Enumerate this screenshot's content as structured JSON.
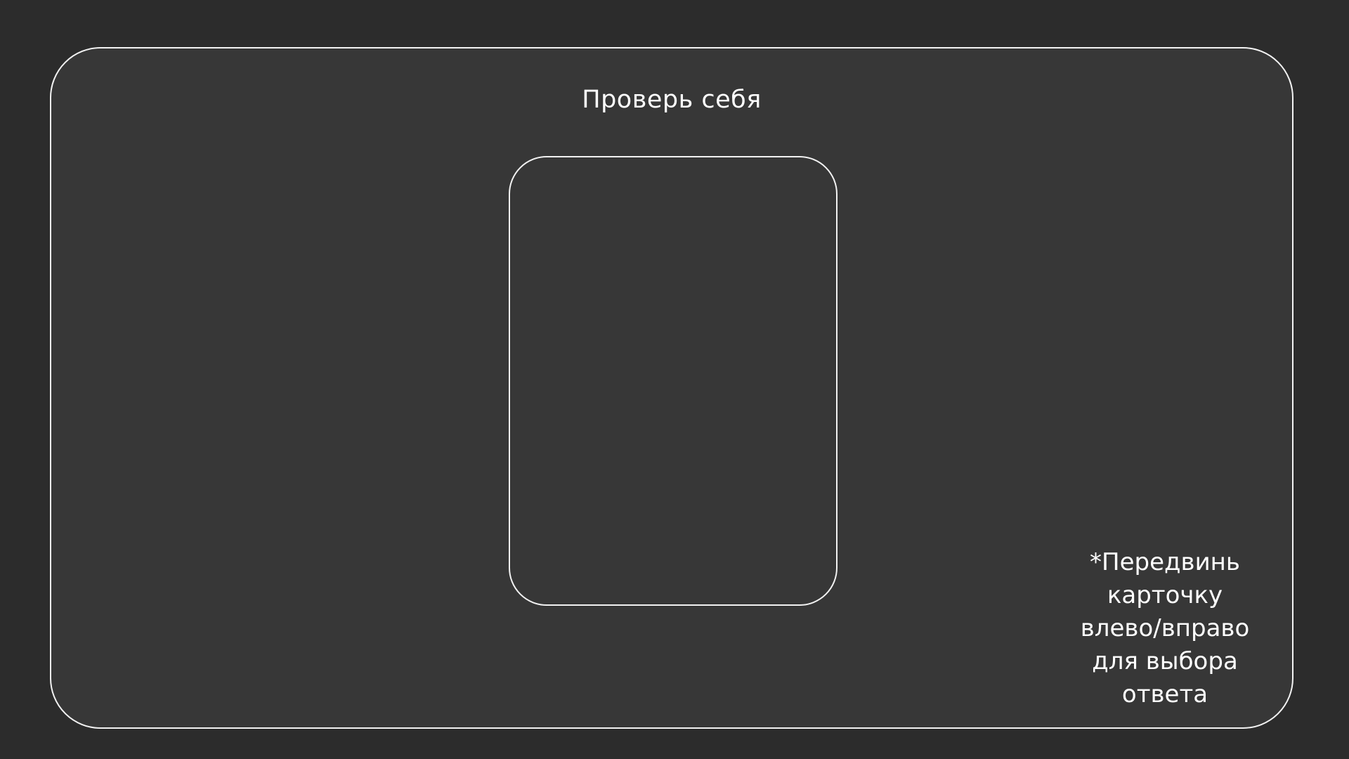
{
  "quiz": {
    "title": "Проверь себя",
    "hint": "*Передвинь\nкарточку\nвлево/вправо\nдля выбора\nответа"
  },
  "colors": {
    "background": "#2c2c2c",
    "panel": "#373737",
    "border": "#f2f2f2",
    "text": "#ffffff"
  }
}
